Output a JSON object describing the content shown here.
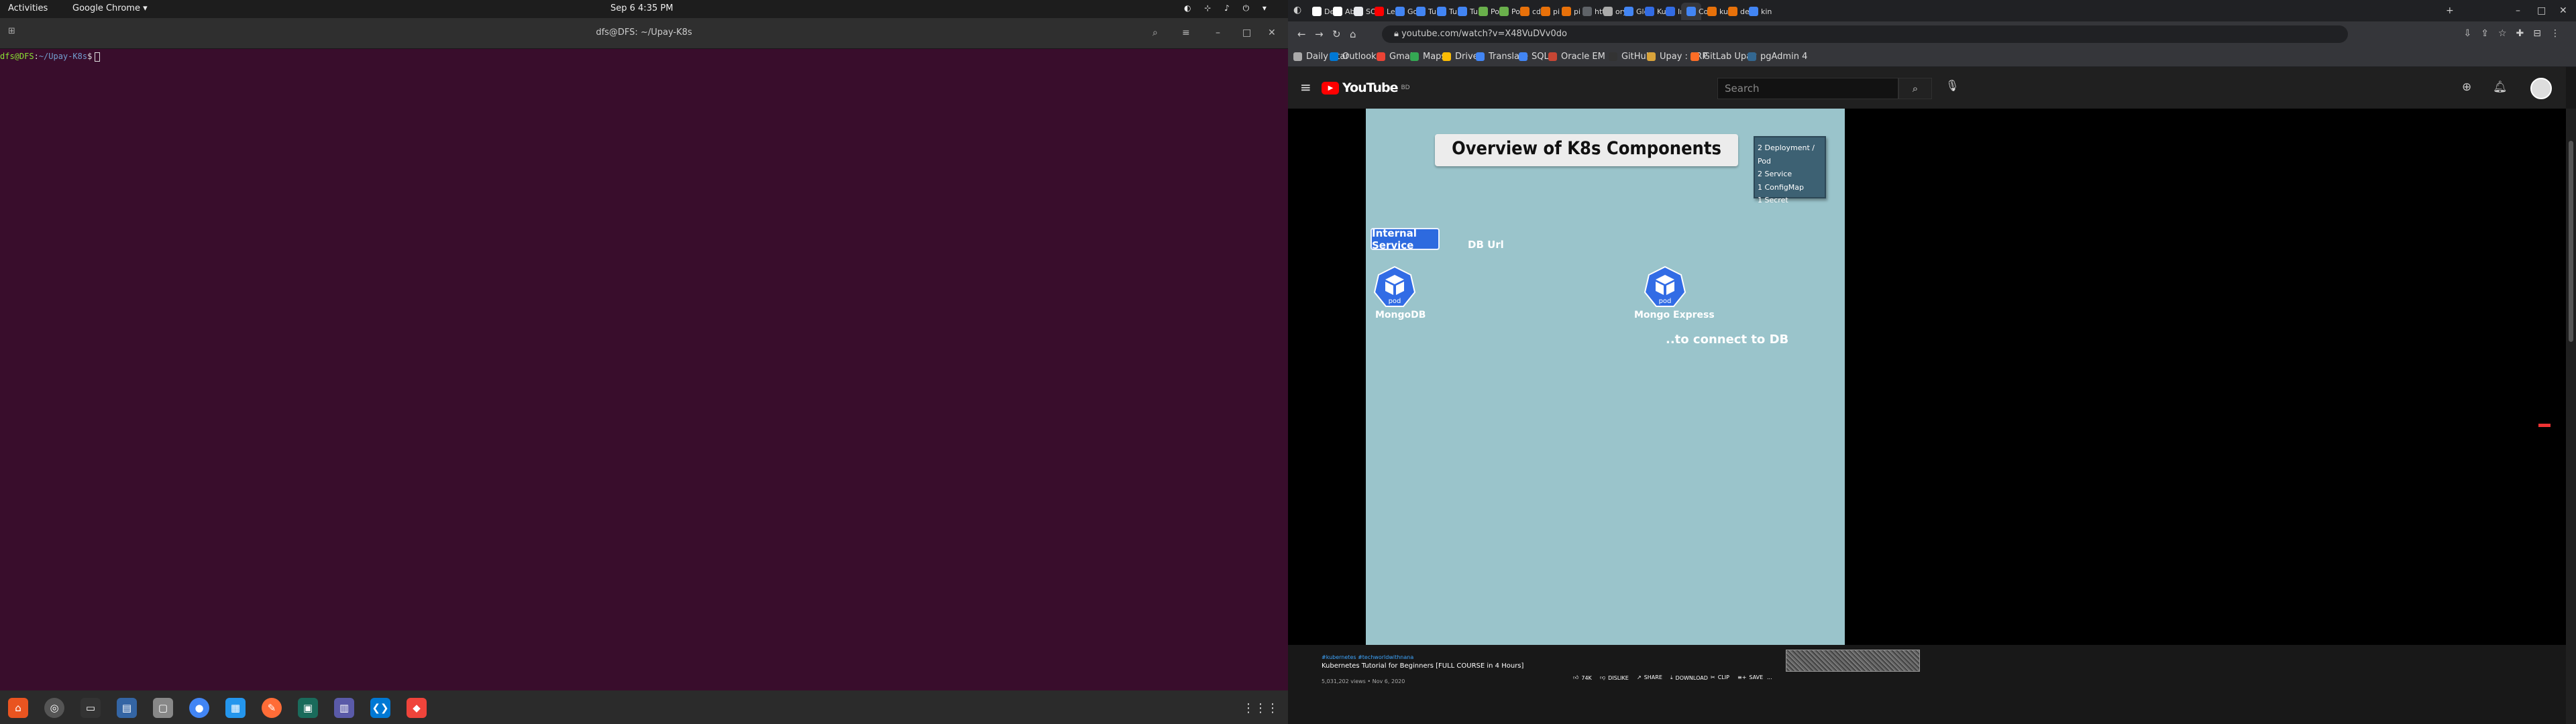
{
  "topbar": {
    "activities": "Activities",
    "app_menu": "Google Chrome ▾",
    "clock": "Sep 6  4:35 PM",
    "tray": "◐ ⊹ ♪ ⏻ ▾"
  },
  "terminal": {
    "title": "dfs@DFS: ~/Upay-K8s",
    "prompt_user": "dfs@DFS",
    "prompt_sep": ":",
    "prompt_path": "~/Upay-K8s",
    "prompt_dollar": "$"
  },
  "dock": {
    "icons": [
      "ubuntu-software-icon",
      "settings-icon",
      "terminal-icon",
      "files-icon",
      "file-manager-icon",
      "chrome-icon",
      "docker-icon",
      "postman-icon",
      "jetbrains-icon",
      "monitor-icon",
      "vscode-icon",
      "anydesk-icon"
    ]
  },
  "chrome": {
    "tabs": [
      "De",
      "Ab",
      "SO",
      "Le",
      "Go",
      "Tu",
      "Tu",
      "Tu",
      "Po",
      "Po",
      "cd",
      "pi",
      "pi",
      "htt",
      "ory",
      "Glo",
      "Ku",
      "Int",
      "Co",
      "ku",
      "de",
      "kin"
    ],
    "url": "youtube.com/watch?v=X48VuDVv0do",
    "bookmarks": [
      "Daily Star",
      "Outlook",
      "Gmail",
      "Maps",
      "Drive",
      "Translate",
      "SQL",
      "Oracle EM",
      "GitHub",
      "Upay : ERP",
      "GitLab Upay",
      "pgAdmin 4"
    ]
  },
  "youtube": {
    "logo": "YouTube",
    "region": "BD",
    "search_placeholder": "Search",
    "slide": {
      "title": "Overview of K8s Components",
      "info": [
        "2 Deployment / Pod",
        "2 Service",
        "1 ConfigMap",
        "1 Secret"
      ],
      "internal_service": "Internal Service",
      "db_url": "DB Url",
      "pod_label": "pod",
      "mongodb": "MongoDB",
      "mongo_express": "Mongo Express",
      "connect": "..to connect to DB"
    },
    "video": {
      "tags": "#kubernetes #techworldwithnana",
      "title": "Kubernetes Tutorial for Beginners [FULL COURSE in 4 Hours]",
      "views": "5,031,202 views • Nov 6, 2020",
      "likes": "74K",
      "dislike": "DISLIKE",
      "share": "SHARE",
      "download": "DOWNLOAD",
      "clip": "CLIP",
      "save": "SAVE",
      "more": "..."
    }
  }
}
